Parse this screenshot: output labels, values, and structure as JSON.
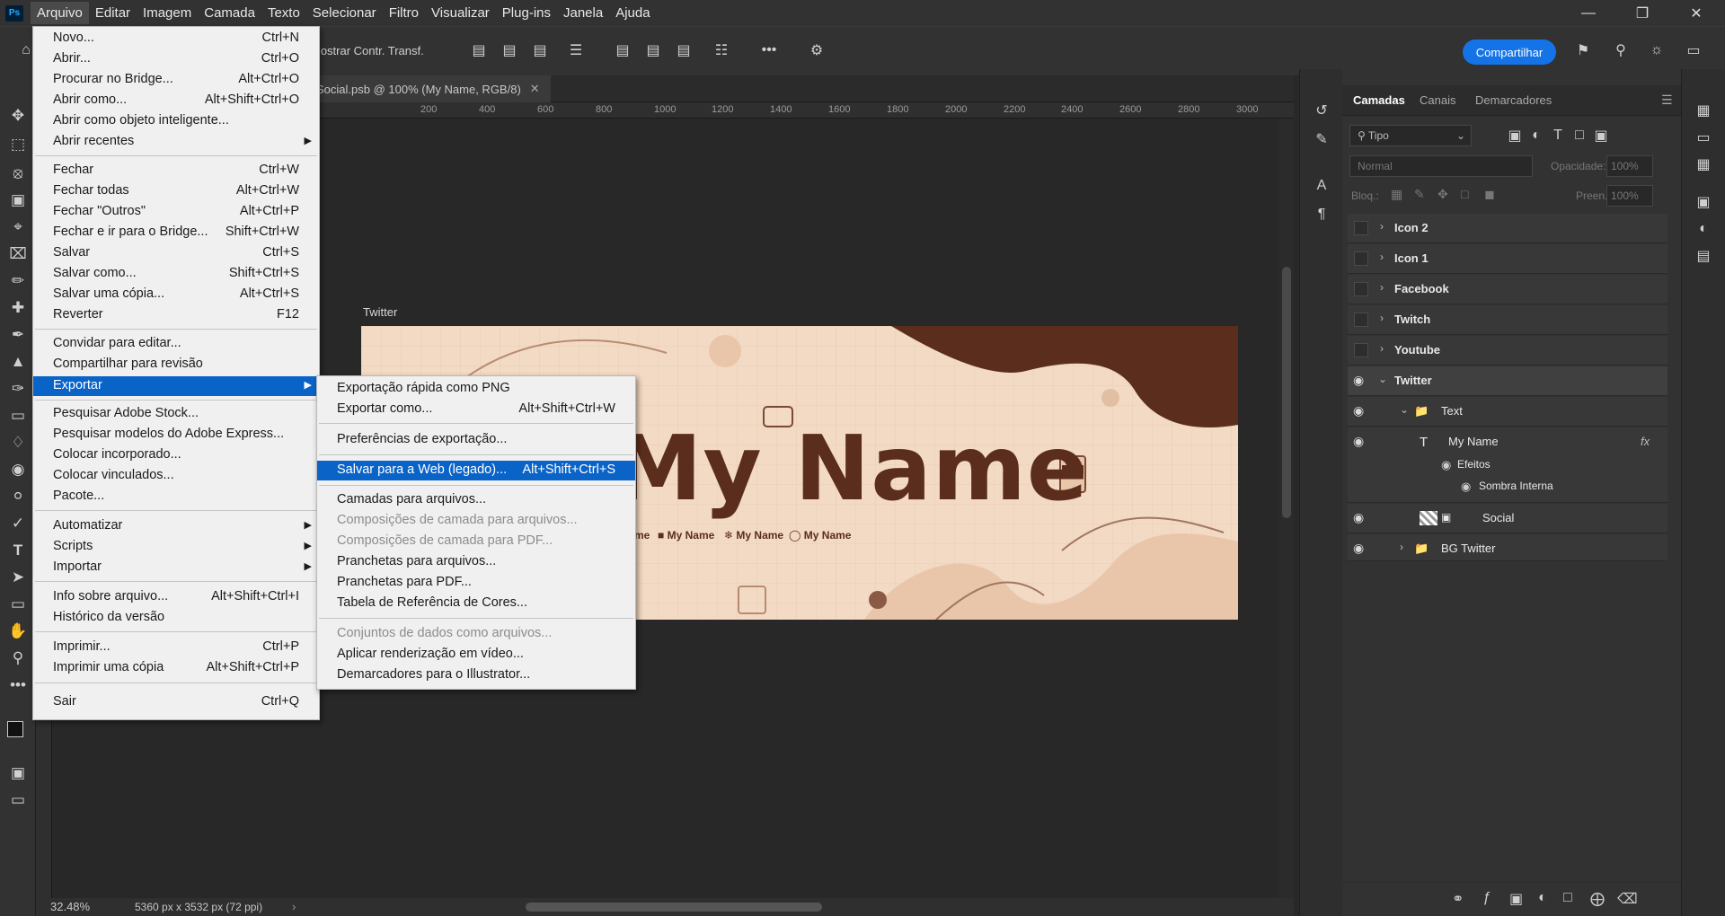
{
  "menubar": {
    "items": [
      "Arquivo",
      "Editar",
      "Imagem",
      "Camada",
      "Texto",
      "Selecionar",
      "Filtro",
      "Visualizar",
      "Plug-ins",
      "Janela",
      "Ajuda"
    ],
    "logo": "Ps"
  },
  "options": {
    "show_transform": "Mostrar Contr. Transf.",
    "share": "Compartilhar"
  },
  "document": {
    "tab_title": "Social.psb @ 100% (My Name, RGB/8)",
    "ruler_ticks": [
      "200",
      "400",
      "600",
      "800",
      "1000",
      "1200",
      "1400",
      "1600",
      "1800",
      "2000",
      "2200",
      "2400",
      "2600",
      "2800",
      "3000"
    ],
    "artboard_label": "Twitter",
    "headline": "My Name",
    "social_handles": [
      {
        "icon": "twitch-icon",
        "label": "My Name"
      },
      {
        "icon": "facebook-icon",
        "label": "My Name"
      },
      {
        "icon": "twitter-icon",
        "label": "My Name"
      },
      {
        "icon": "instagram-icon",
        "label": "My Name"
      }
    ]
  },
  "status": {
    "zoom": "32.48%",
    "size": "5360 px x 3532 px (72 ppi)"
  },
  "file_menu": [
    {
      "label": "Novo...",
      "shortcut": "Ctrl+N"
    },
    {
      "label": "Abrir...",
      "shortcut": "Ctrl+O"
    },
    {
      "label": "Procurar no Bridge...",
      "shortcut": "Alt+Ctrl+O"
    },
    {
      "label": "Abrir como...",
      "shortcut": "Alt+Shift+Ctrl+O"
    },
    {
      "label": "Abrir como objeto inteligente...",
      "shortcut": ""
    },
    {
      "label": "Abrir recentes",
      "shortcut": ""
    },
    {
      "label": "Fechar",
      "shortcut": "Ctrl+W"
    },
    {
      "label": "Fechar todas",
      "shortcut": "Alt+Ctrl+W"
    },
    {
      "label": "Fechar \"Outros\"",
      "shortcut": "Alt+Ctrl+P"
    },
    {
      "label": "Fechar e ir para o Bridge...",
      "shortcut": "Shift+Ctrl+W"
    },
    {
      "label": "Salvar",
      "shortcut": "Ctrl+S"
    },
    {
      "label": "Salvar como...",
      "shortcut": "Shift+Ctrl+S"
    },
    {
      "label": "Salvar uma cópia...",
      "shortcut": "Alt+Ctrl+S"
    },
    {
      "label": "Reverter",
      "shortcut": "F12"
    },
    {
      "label": "Convidar para editar...",
      "shortcut": ""
    },
    {
      "label": "Compartilhar para revisão",
      "shortcut": ""
    },
    {
      "label": "Exportar",
      "shortcut": ""
    },
    {
      "label": "Pesquisar Adobe Stock...",
      "shortcut": ""
    },
    {
      "label": "Pesquisar modelos do Adobe Express...",
      "shortcut": ""
    },
    {
      "label": "Colocar incorporado...",
      "shortcut": ""
    },
    {
      "label": "Colocar vinculados...",
      "shortcut": ""
    },
    {
      "label": "Pacote...",
      "shortcut": ""
    },
    {
      "label": "Automatizar",
      "shortcut": ""
    },
    {
      "label": "Scripts",
      "shortcut": ""
    },
    {
      "label": "Importar",
      "shortcut": ""
    },
    {
      "label": "Info sobre arquivo...",
      "shortcut": "Alt+Shift+Ctrl+I"
    },
    {
      "label": "Histórico da versão",
      "shortcut": ""
    },
    {
      "label": "Imprimir...",
      "shortcut": "Ctrl+P"
    },
    {
      "label": "Imprimir uma cópia",
      "shortcut": "Alt+Shift+Ctrl+P"
    },
    {
      "label": "Sair",
      "shortcut": "Ctrl+Q"
    }
  ],
  "export_menu": [
    {
      "label": "Exportação rápida como PNG",
      "shortcut": ""
    },
    {
      "label": "Exportar como...",
      "shortcut": "Alt+Shift+Ctrl+W"
    },
    {
      "label": "Preferências de exportação...",
      "shortcut": ""
    },
    {
      "label": "Salvar para a Web (legado)...",
      "shortcut": "Alt+Shift+Ctrl+S"
    },
    {
      "label": "Camadas para arquivos...",
      "shortcut": ""
    },
    {
      "label": "Composições de camada para arquivos...",
      "shortcut": ""
    },
    {
      "label": "Composições de camada para PDF...",
      "shortcut": ""
    },
    {
      "label": "Pranchetas para arquivos...",
      "shortcut": ""
    },
    {
      "label": "Pranchetas para PDF...",
      "shortcut": ""
    },
    {
      "label": "Tabela de Referência de Cores...",
      "shortcut": ""
    },
    {
      "label": "Conjuntos de dados como arquivos...",
      "shortcut": ""
    },
    {
      "label": "Aplicar renderização em vídeo...",
      "shortcut": ""
    },
    {
      "label": "Demarcadores para o Illustrator...",
      "shortcut": ""
    }
  ],
  "layers_panel": {
    "tabs": [
      "Camadas",
      "Canais",
      "Demarcadores"
    ],
    "filter": "Tipo",
    "blend_mode": "Normal",
    "opacity_label": "Opacidade:",
    "opacity_value": "100%",
    "lock_label": "Bloq.:",
    "fill_label": "Preen.:",
    "fill_value": "100%",
    "fx": "fx",
    "layers": [
      {
        "name": "Icon 2"
      },
      {
        "name": "Icon 1"
      },
      {
        "name": "Facebook"
      },
      {
        "name": "Twitch"
      },
      {
        "name": "Youtube"
      },
      {
        "name": "Twitter"
      },
      {
        "name": "Text"
      },
      {
        "name": "My Name"
      },
      {
        "name": "Efeitos"
      },
      {
        "name": "Sombra Interna"
      },
      {
        "name": "Social"
      },
      {
        "name": "BG Twitter"
      }
    ]
  }
}
